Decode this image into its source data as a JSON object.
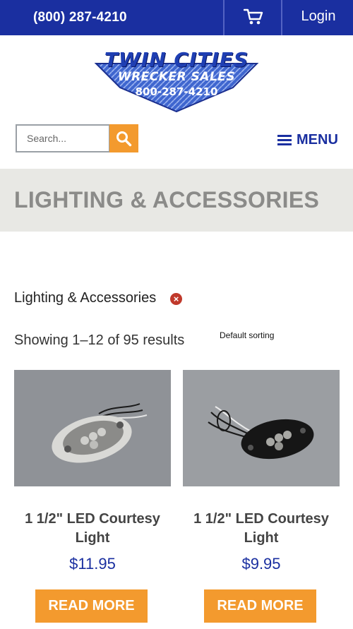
{
  "header": {
    "phone": "(800) 287-4210",
    "login_label": "Login",
    "cart_icon": "cart-icon",
    "colors": {
      "bar": "#1a2fa0",
      "accent": "#f39a2e"
    }
  },
  "logo": {
    "line1": "TWIN CITIES",
    "line2": "WRECKER SALES",
    "line3": "800-287-4210"
  },
  "search": {
    "placeholder": "Search...",
    "value": "",
    "button_icon": "search-icon"
  },
  "nav": {
    "menu_label": "MENU",
    "menu_icon": "hamburger-icon"
  },
  "page": {
    "title": "LIGHTING & ACCESSORIES",
    "active_filter": "Lighting & Accessories",
    "results_text": "Showing 1–12 of 95 results",
    "sorting": "Default sorting"
  },
  "products": [
    {
      "name": "1 1/2\" LED Courtesy Light",
      "price": "$11.95",
      "button": "READ MORE",
      "finish": "chrome"
    },
    {
      "name": "1 1/2\" LED Courtesy Light",
      "price": "$9.95",
      "button": "READ MORE",
      "finish": "black"
    }
  ]
}
